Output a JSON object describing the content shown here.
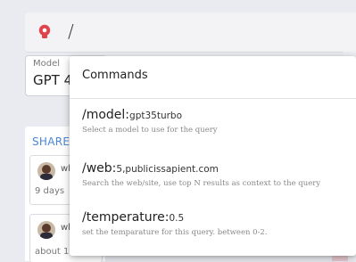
{
  "query": {
    "text": "/",
    "icon": "bulb-icon"
  },
  "model": {
    "label": "Model",
    "value": "GPT 4"
  },
  "shared": {
    "title": "SHARED",
    "cards": [
      {
        "who": "wh",
        "time": "9 days"
      },
      {
        "who": "wh",
        "time": "about 1"
      }
    ]
  },
  "popup": {
    "title": "Commands",
    "commands": [
      {
        "name": "/model:",
        "arg": "gpt35turbo",
        "desc": "Select a model to use for the query"
      },
      {
        "name": "/web:",
        "arg": "5,publicissapient.com",
        "desc": "Search the web/site, use top N results as context to the query"
      },
      {
        "name": "/temperature:",
        "arg": "0.5",
        "desc": "set the temparature for this query. between 0-2."
      }
    ]
  },
  "colors": {
    "accent": "#4a86d6",
    "icon": "#e0434b"
  }
}
